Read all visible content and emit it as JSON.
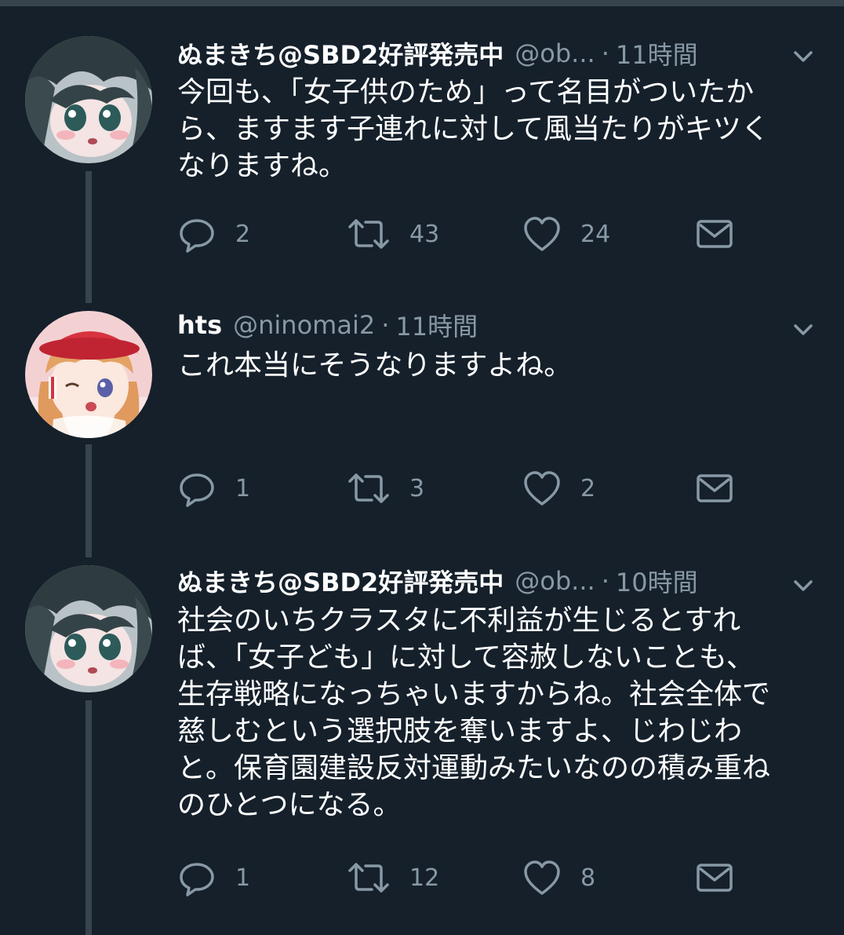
{
  "tweets": [
    {
      "name": "ぬまきち@SBD2好評発売中",
      "handle": "@ob...",
      "dot": "·",
      "time": "11時間",
      "lines": [
        "今回も、「女子供のため」って名目がついたか",
        "ら、ますます子連れに対して風当たりがキツく",
        "なりますね。"
      ],
      "replies": "2",
      "retweets": "43",
      "likes": "24",
      "avatar_icon": "avatar-anime-girl-dark-hair"
    },
    {
      "name": "hts",
      "handle": "@ninomai2",
      "dot": "·",
      "time": "11時間",
      "lines": [
        "これ本当にそうなりますよね。"
      ],
      "replies": "1",
      "retweets": "3",
      "likes": "2",
      "avatar_icon": "avatar-anime-girl-red-hat"
    },
    {
      "name": "ぬまきち@SBD2好評発売中",
      "handle": "@ob...",
      "dot": "·",
      "time": "10時間",
      "lines": [
        "社会のいちクラスタに不利益が生じるとすれ",
        "ば、「女子ども」に対して容赦しないことも、",
        "生存戦略になっちゃいますからね。社会全体で",
        "慈しむという選択肢を奪いますよ、じわじわ",
        "と。保育園建設反対運動みたいなのの積み重ね",
        "のひとつになる。"
      ],
      "replies": "1",
      "retweets": "12",
      "likes": "8",
      "avatar_icon": "avatar-anime-girl-dark-hair"
    }
  ],
  "icons": {
    "reply": "reply-icon",
    "retweet": "retweet-icon",
    "like": "heart-icon",
    "dm": "direct-message-icon",
    "more": "chevron-down-icon"
  },
  "colors": {
    "background": "#15202b",
    "secondary_text": "#8899a6",
    "thread_line": "#38444d",
    "primary_text": "#ffffff"
  }
}
